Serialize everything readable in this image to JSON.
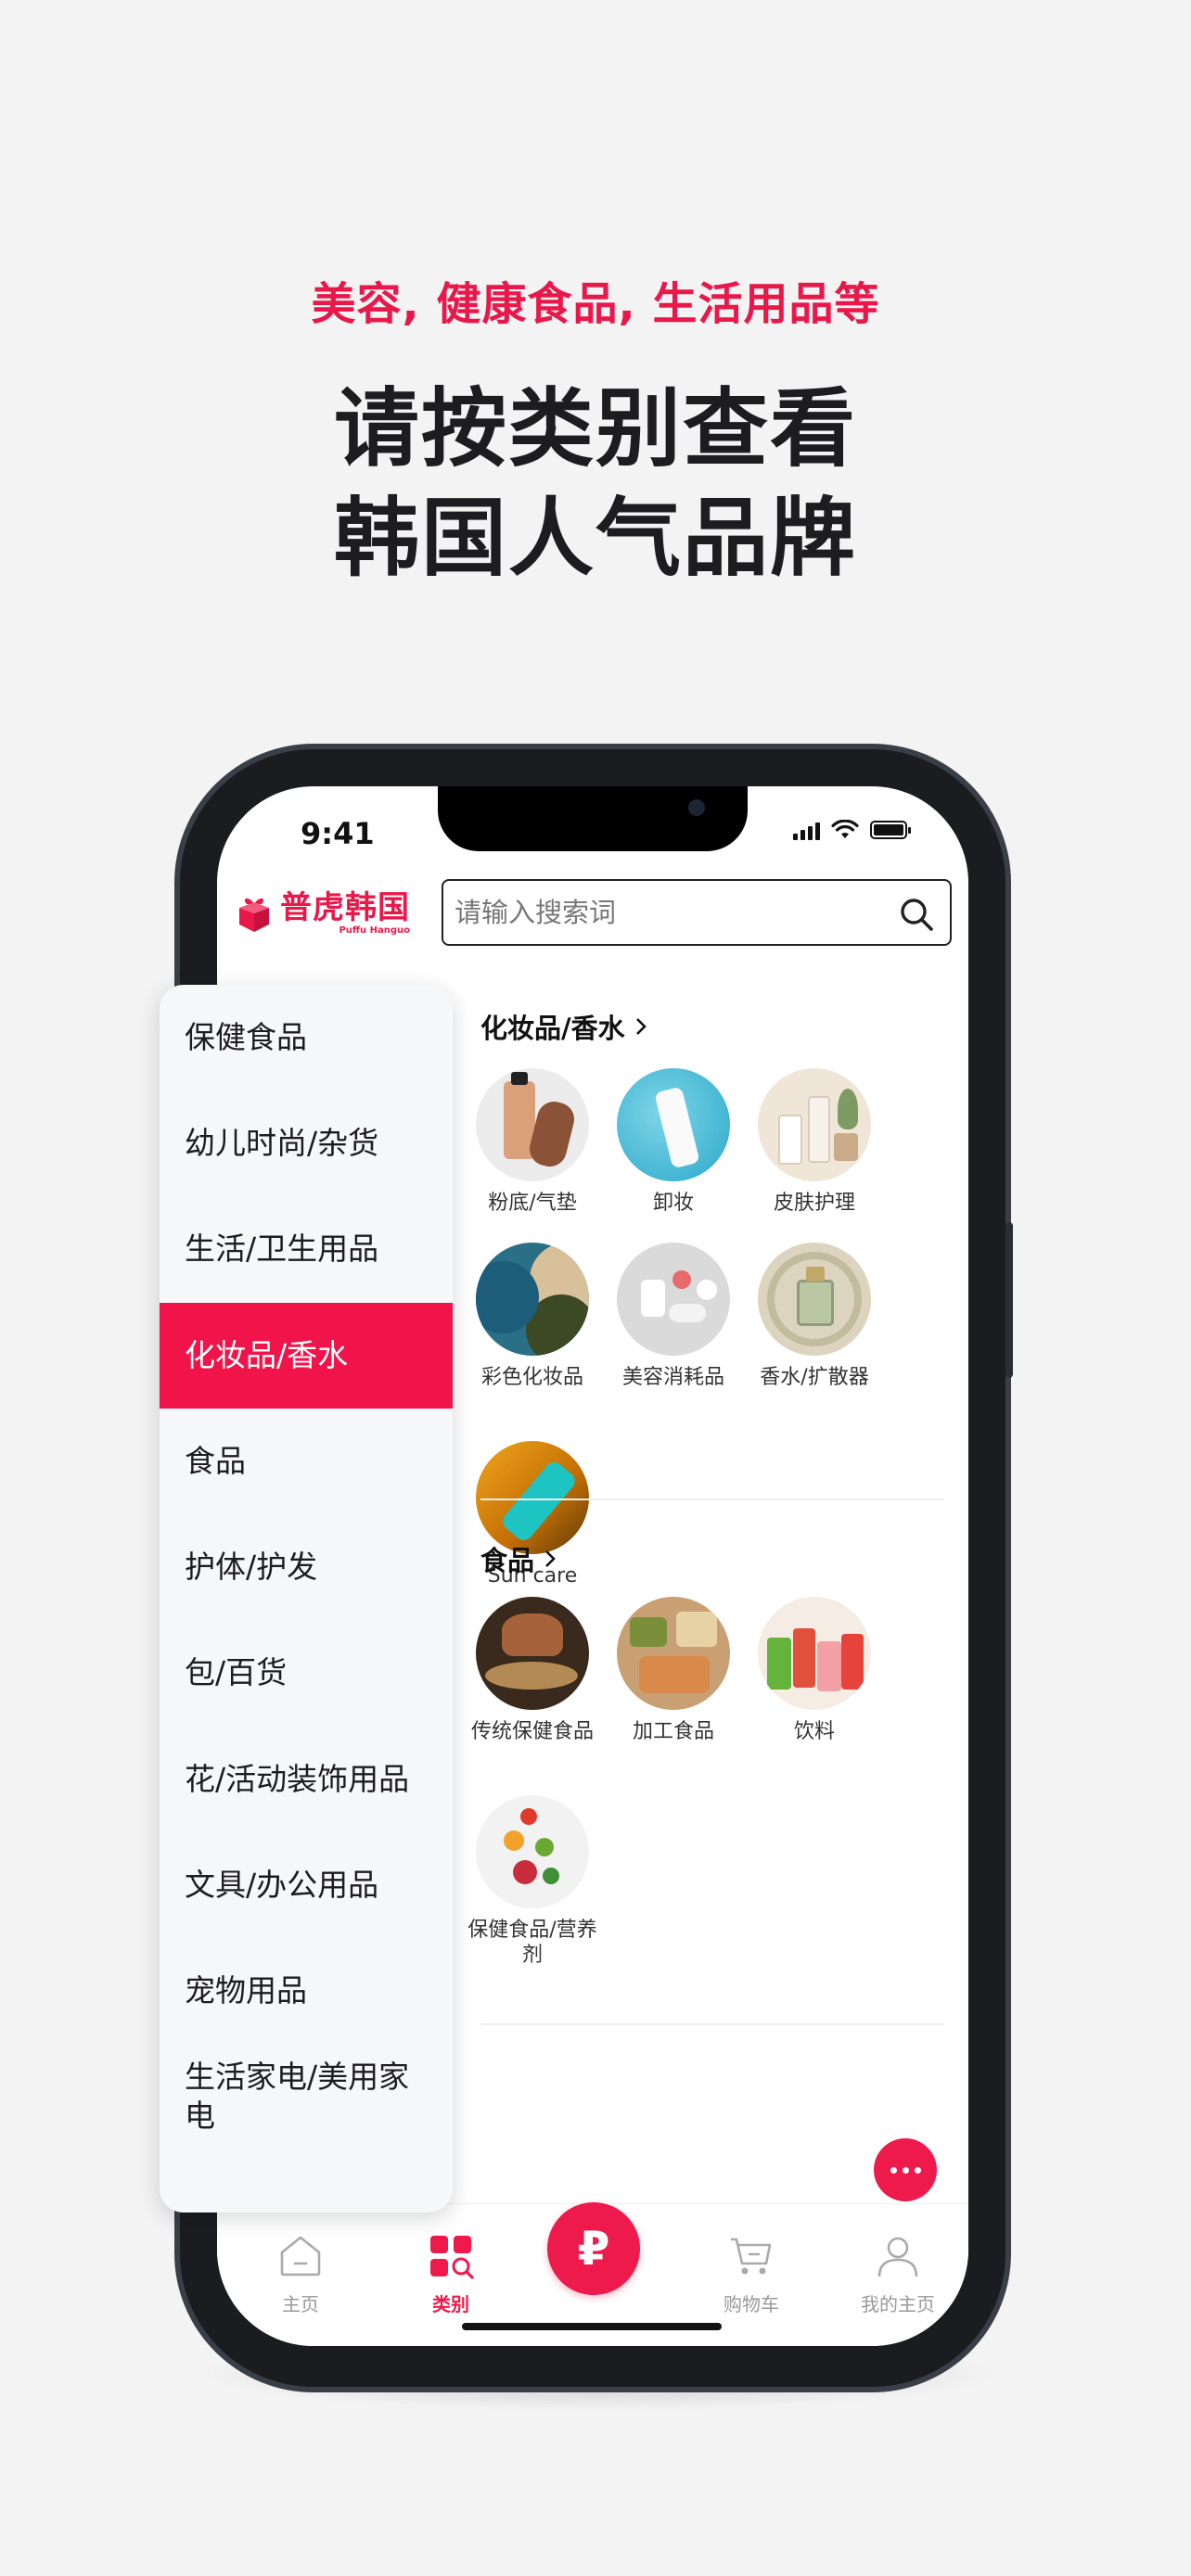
{
  "promo": {
    "subtitle": "美容, 健康食品, 生活用品等",
    "title_line1": "请按类别查看",
    "title_line2": "韩国人气品牌"
  },
  "status_bar": {
    "time": "9:41"
  },
  "header": {
    "logo_text": "普虎韩国",
    "logo_sub": "Puffu Hanguo",
    "search_placeholder": "请输入搜索词"
  },
  "sidebar": {
    "items": [
      {
        "label": "保健食品"
      },
      {
        "label": "幼儿时尚/杂货"
      },
      {
        "label": "生活/卫生用品"
      },
      {
        "label": "化妆品/香水",
        "active": true
      },
      {
        "label": "食品"
      },
      {
        "label": "护体/护发"
      },
      {
        "label": "包/百货"
      },
      {
        "label": "花/活动装饰用品"
      },
      {
        "label": "文具/办公用品"
      },
      {
        "label": "宠物用品"
      },
      {
        "label": "生活家电/美用家电"
      }
    ]
  },
  "sections": [
    {
      "title": "化妆品/香水",
      "items": [
        {
          "label": "粉底/气垫",
          "icon": "foundation-image"
        },
        {
          "label": "卸妆",
          "icon": "cleanser-image"
        },
        {
          "label": "皮肤护理",
          "icon": "skincare-image"
        },
        {
          "label": "彩色化妆品",
          "icon": "eyeshadow-image"
        },
        {
          "label": "美容消耗品",
          "icon": "beauty-supplies-image"
        },
        {
          "label": "香水/扩散器",
          "icon": "perfume-image"
        },
        {
          "label": "Sun care",
          "icon": "suncare-image"
        }
      ]
    },
    {
      "title": "食品",
      "items": [
        {
          "label": "传统保健食品",
          "icon": "traditional-food-image"
        },
        {
          "label": "加工食品",
          "icon": "processed-food-image"
        },
        {
          "label": "饮料",
          "icon": "drinks-image"
        },
        {
          "label": "保健食品/营养剂",
          "icon": "supplements-image"
        }
      ]
    }
  ],
  "tabbar": {
    "home": "主页",
    "category": "类别",
    "center": "₽",
    "cart": "购物车",
    "my": "我的主页"
  },
  "colors": {
    "brand": "#ef1a4c",
    "text": "#1d1d1f"
  }
}
